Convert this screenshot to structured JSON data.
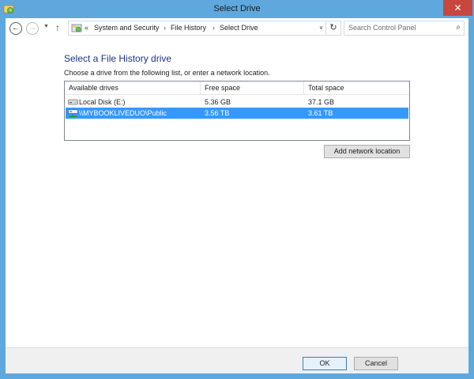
{
  "window": {
    "title": "Select Drive",
    "close_glyph": "✕",
    "accent_color": "#5fa8dd"
  },
  "nav": {
    "back_glyph": "←",
    "forward_glyph": "→",
    "recent_glyph": "▼",
    "up_glyph": "↑",
    "breadcrumb_overflow": "«",
    "breadcrumb": [
      "System and Security",
      "File History",
      "Select Drive"
    ],
    "separator": "›",
    "dropdown_glyph": "∨",
    "refresh_glyph": "↻",
    "search_placeholder": "Search Control Panel",
    "search_glyph": "⌕"
  },
  "content": {
    "heading": "Select a File History drive",
    "instruction": "Choose a drive from the following list, or enter a network location.",
    "columns": [
      "Available drives",
      "Free space",
      "Total space"
    ],
    "drives": [
      {
        "name": "Local Disk (E:)",
        "free": "5.36 GB",
        "total": "37.1 GB",
        "icon": "local-disk-icon",
        "selected": false
      },
      {
        "name": "\\\\MYBOOKLIVEDUO\\Public",
        "free": "3.56 TB",
        "total": "3.61 TB",
        "icon": "network-drive-icon",
        "selected": true
      }
    ],
    "add_network_label": "Add network location"
  },
  "footer": {
    "ok_label": "OK",
    "cancel_label": "Cancel"
  },
  "colors": {
    "selection": "#3399ff",
    "heading": "#1e3287"
  }
}
